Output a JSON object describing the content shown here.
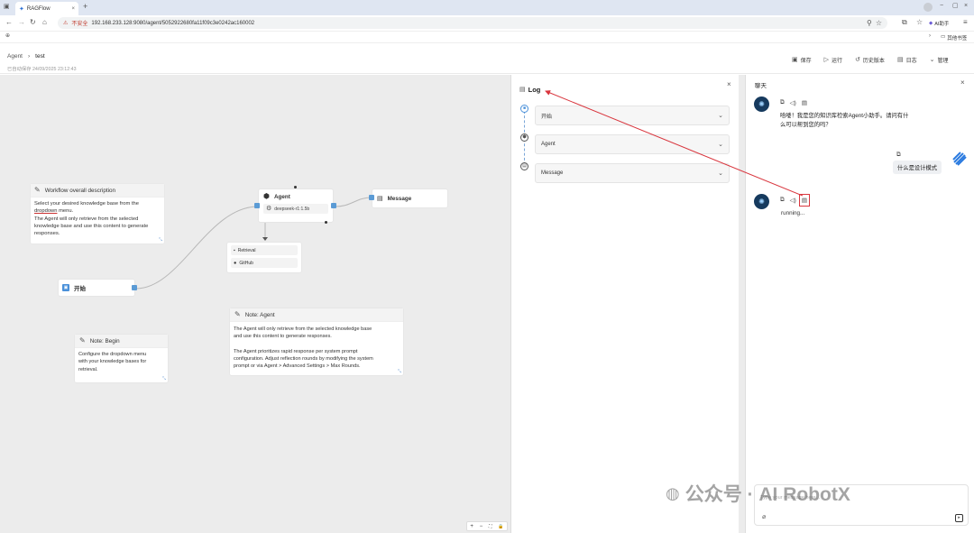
{
  "browser": {
    "tab_title": "RAGFlow",
    "tab_close": "×",
    "new_tab": "+",
    "insecure_label": "不安全",
    "url": "192.168.233.128:9080/agent/5052922680fa11f09c3e0242ac160002",
    "ai_label": "AI助手",
    "bookmarks_label": "其他书签",
    "window_controls": [
      "−",
      "▢",
      "×"
    ]
  },
  "header": {
    "breadcrumb_root": "Agent",
    "breadcrumb_sep": "›",
    "breadcrumb_current": "test",
    "saved_text": "已自动保存 24/09/2025 23:12:43",
    "toolbar": [
      {
        "label": "保存",
        "icon": "save-icon"
      },
      {
        "label": "运行",
        "icon": "play-icon"
      },
      {
        "label": "历史版本",
        "icon": "history-icon"
      },
      {
        "label": "日志",
        "icon": "log-icon"
      },
      {
        "label": "管理",
        "icon": "chevron-down-icon"
      }
    ]
  },
  "canvas": {
    "workflow_note": {
      "title": "Workflow overall description",
      "line1a": "Select your desired knowledge base from the",
      "line2_link": "dropdown",
      "line2_rest": " menu.",
      "line3": "The Agent will only retrieve from the selected",
      "line4": "knowledge base and use this content  to generate",
      "line5": "responses."
    },
    "begin_node": {
      "label": "开始"
    },
    "agent_node": {
      "title": "Agent",
      "model": "deepseek-r1:1.5b"
    },
    "message_node": {
      "title": "Message"
    },
    "tools": [
      "Retrieval",
      "GitHub"
    ],
    "note_begin": {
      "title": "Note: Begin",
      "lines": [
        "Configure the dropdown menu",
        "with your knowledge bases for",
        "retrieval."
      ]
    },
    "note_agent": {
      "title": "Note: Agent",
      "lines": [
        "The Agent will only retrieve from the selected knowledge base",
        "and use this content to generate responses.",
        "",
        "The Agent prioritizes rapid response per system prompt",
        "configuration. Adjust reflection rounds by modifying the system",
        "prompt or via Agent > Advanced Settings > Max Rounds."
      ]
    },
    "zoom_controls": [
      "+",
      "−",
      "⛶",
      "🔒"
    ]
  },
  "log": {
    "title": "Log",
    "close": "×",
    "items": [
      "开始",
      "Agent",
      "Message"
    ]
  },
  "chat": {
    "title": "聊天",
    "close": "×",
    "assistant_greeting": "哈喽！我是您的知识库检索Agent小助手。请问有什么可以帮到您的吗？",
    "greeting_line1": "哈喽！我是您的知识库检索Agent小助手。请问有什",
    "greeting_line2": "么可以帮到您的吗？",
    "user_message": "什么是设计模式",
    "running_text": "running...",
    "input_placeholder": "Type your message here...",
    "watermark": "公众号 · AI RobotX"
  },
  "colors": {
    "accent": "#4a90d9",
    "canvas_bg": "#ececec",
    "annotation_red": "#d9363e",
    "avatar_bg": "#163a5e"
  }
}
